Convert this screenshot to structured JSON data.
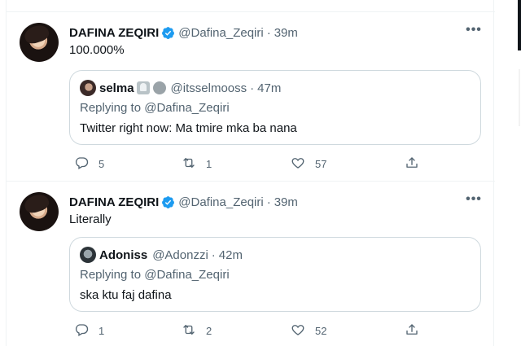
{
  "tweets": [
    {
      "author_name": "DAFINA ZEQIRI",
      "author_handle": "@Dafina_Zeqiri",
      "separator": "·",
      "time": "39m",
      "text": "100.000%",
      "more_icon": "more-horizontal-icon",
      "quote": {
        "author_name": "selma",
        "author_handle": "@itsselmooss",
        "separator": "·",
        "time": "47m",
        "replying_prefix": "Replying to",
        "replying_handle": "@Dafina_Zeqiri",
        "text": "Twitter right now: Ma tmire mka ba nana"
      },
      "actions": {
        "replies": "5",
        "retweets": "1",
        "likes": "57"
      }
    },
    {
      "author_name": "DAFINA ZEQIRI",
      "author_handle": "@Dafina_Zeqiri",
      "separator": "·",
      "time": "39m",
      "text": "Literally",
      "more_icon": "more-horizontal-icon",
      "quote": {
        "author_name": "Adoniss",
        "author_handle": "@Adonzzi",
        "separator": "·",
        "time": "42m",
        "replying_prefix": "Replying to",
        "replying_handle": "@Dafina_Zeqiri",
        "text": "ska ktu faj dafina"
      },
      "actions": {
        "replies": "1",
        "retweets": "2",
        "likes": "52"
      }
    }
  ],
  "colors": {
    "verified": "#1d9bf0",
    "secondary_text": "#536471",
    "primary_text": "#0f1419",
    "border": "#cfd9de"
  },
  "more_glyph": "•••"
}
